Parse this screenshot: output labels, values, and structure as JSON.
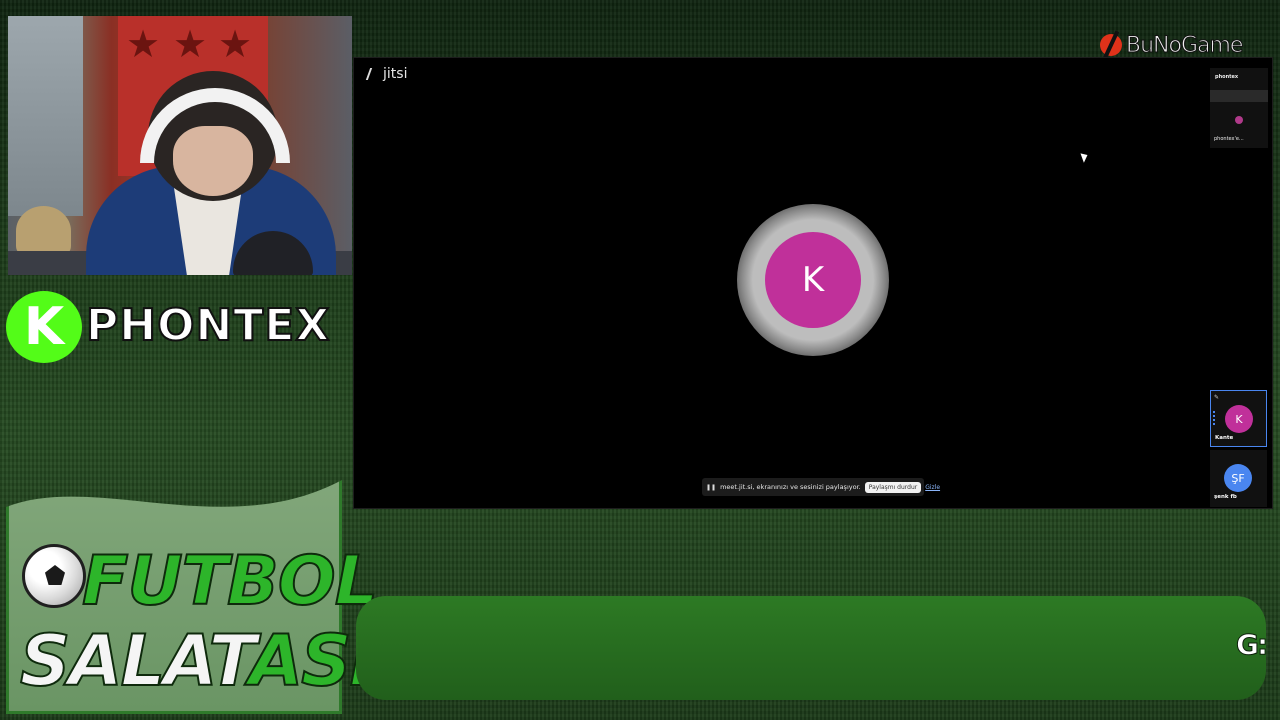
{
  "overlay": {
    "streamer_name": "PHONTEX",
    "kick_logo_letter": "K",
    "show_title_line1": "FUTBOL",
    "show_title_line2_white": "SALAT",
    "show_title_line2_green": "ASI",
    "network_logo": "BuNoGame",
    "ticker_text": "G:",
    "colors": {
      "kick_green": "#53fc18",
      "ticker_green": "#2d7a24",
      "accent_magenta": "#c0309a"
    }
  },
  "jitsi": {
    "logo_text": "jitsi",
    "main_avatar_initial": "K",
    "share_notice": "meet.jit.si, ekranınızı ve sesinizi paylaşıyor.",
    "stop_sharing_label": "Paylaşmı durdur",
    "hide_label": "Gizle",
    "participants": [
      {
        "top_label": "phontex",
        "bottom_label": "phontex'e..."
      },
      {
        "initial": "K",
        "name": "Kante"
      },
      {
        "initial": "ŞF",
        "name": "şenk fb"
      }
    ]
  }
}
